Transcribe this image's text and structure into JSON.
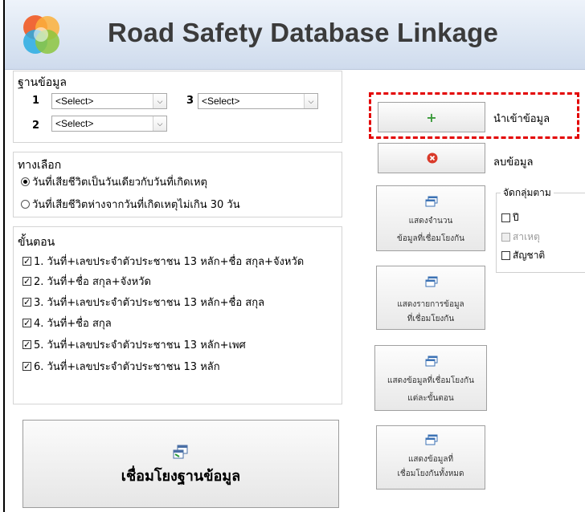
{
  "app": {
    "title": "Road Safety Database Linkage"
  },
  "database": {
    "title": "ฐานข้อมูล",
    "slots": [
      {
        "label": "1",
        "value": "<Select>"
      },
      {
        "label": "3",
        "value": "<Select>"
      },
      {
        "label": "2",
        "value": "<Select>"
      }
    ]
  },
  "options": {
    "title": "ทางเลือก",
    "items": [
      {
        "label": "วันที่เสียชีวิตเป็นวันเดียวกับวันที่เกิดเหตุ",
        "selected": true
      },
      {
        "label": "วันที่เสียชีวิตห่างจากวันที่เกิดเหตุไม่เกิน 30 วัน",
        "selected": false
      }
    ]
  },
  "steps": {
    "title": "ขั้นตอน",
    "items": [
      {
        "label": "1. วันที่+เลขประจำตัวประชาชน 13 หลัก+ชื่อ สกุล+จังหวัด",
        "checked": true
      },
      {
        "label": "2. วันที่+ชื่อ สกุล+จังหวัด",
        "checked": true
      },
      {
        "label": "3. วันที่+เลขประจำตัวประชาชน 13 หลัก+ชื่อ สกุล",
        "checked": true
      },
      {
        "label": "4. วันที่+ชื่อ สกุล",
        "checked": true
      },
      {
        "label": "5. วันที่+เลขประจำตัวประชาชน 13 หลัก+เพศ",
        "checked": true
      },
      {
        "label": "6. วันที่+เลขประจำตัวประชาชน 13 หลัก",
        "checked": true
      }
    ]
  },
  "link_button": {
    "label": "เชื่อมโยงฐานข้อมูล",
    "icon": "link-database-icon"
  },
  "import": {
    "label": "นำเข้าข้อมูล",
    "icon": "plus-icon",
    "color": "#3a9a3a"
  },
  "delete": {
    "label": "ลบข้อมูล",
    "icon": "delete-icon",
    "color": "#d93a2a"
  },
  "actions": [
    {
      "line1": "แสดงจำนวน",
      "line2": "ข้อมูลที่เชื่อมโยงกัน",
      "icon": "window-icon"
    },
    {
      "line1": "แสดงรายการข้อมูล",
      "line2": "ที่เชื่อมโยงกัน",
      "icon": "window-icon"
    },
    {
      "line1": "แสดงข้อมูลที่เชื่อมโยงกัน",
      "line2": "แต่ละขั้นตอน",
      "icon": "window-icon"
    },
    {
      "line1": "แสดงข้อมูลที่",
      "line2": "เชื่อมโยงกันทั้งหมด",
      "icon": "window-icon"
    }
  ],
  "group_by": {
    "title": "จัดกลุ่มตาม",
    "items": [
      {
        "label": "ปี",
        "checked": false,
        "enabled": true
      },
      {
        "label": "สาเหตุ",
        "checked": false,
        "enabled": false
      },
      {
        "label": "สัญชาติ",
        "checked": false,
        "enabled": true
      }
    ]
  },
  "highlight_color": "#e30000"
}
